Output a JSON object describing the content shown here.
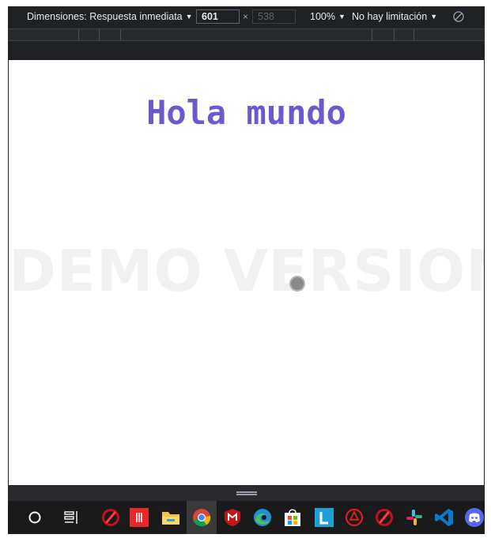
{
  "toolbar": {
    "dimensions_label": "Dimensiones: Respuesta inmediata",
    "width_value": "601",
    "height_value": "538",
    "times_symbol": "×",
    "zoom_label": "100%",
    "throttle_label": "No hay limitación"
  },
  "page": {
    "heading": "Hola mundo",
    "watermark": "DEMO VERSION"
  },
  "taskbar": {
    "icons": [
      "search-circle-icon",
      "task-view-icon",
      "brush-app-icon",
      "red-app-icon",
      "file-explorer-icon",
      "chrome-icon",
      "mcafee-icon",
      "edge-icon",
      "store-icon",
      "l-app-icon",
      "red-app-icon-2",
      "brush-app-icon-2",
      "slack-icon",
      "vscode-icon",
      "discord-icon"
    ]
  },
  "colors": {
    "heading": "#6a5acd",
    "watermark": "#f1f1f1",
    "devtools_bg": "#202124"
  }
}
